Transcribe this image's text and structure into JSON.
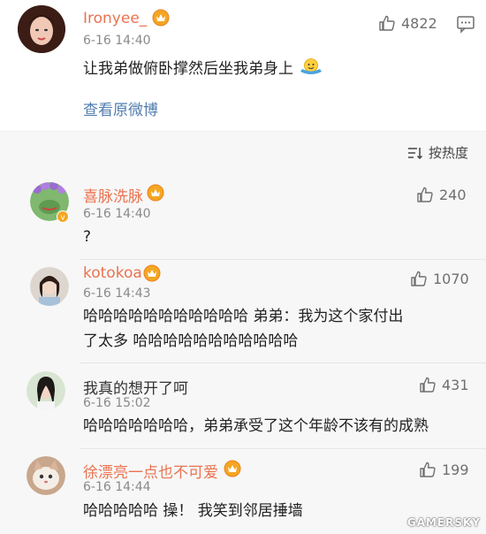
{
  "post": {
    "username": "Ironyee_",
    "time": "6-16 14:40",
    "likes": "4822",
    "text": "让我弟做俯卧撑然后坐我弟身上",
    "emoji": "emoji-icon",
    "view_original": "查看原微博"
  },
  "sort": {
    "label": "按热度"
  },
  "comments": [
    {
      "username": "喜脉洗脉",
      "time": "6-16 14:40",
      "likes": "240",
      "text": "?"
    },
    {
      "username": "kotokoa",
      "time": "6-16 14:43",
      "likes": "1070",
      "text_line1": "哈哈哈哈哈哈哈哈哈哈哈 弟弟：我为这个家付出",
      "text_line2": "了太多 哈哈哈哈哈哈哈哈哈哈哈"
    },
    {
      "username": "我真的想开了呵",
      "time": "6-16 15:02",
      "likes": "431",
      "text": "哈哈哈哈哈哈哈，弟弟承受了这个年龄不该有的成熟"
    },
    {
      "username": "徐漂亮一点也不可爱",
      "time": "6-16 14:44",
      "likes": "199",
      "text": "哈哈哈哈哈 操！ 我笑到邻居捶墙"
    }
  ],
  "watermark": "GAMERSKY",
  "colors": {
    "accent": "#eb7350",
    "link": "#507daf",
    "muted": "#8a8a8a"
  }
}
